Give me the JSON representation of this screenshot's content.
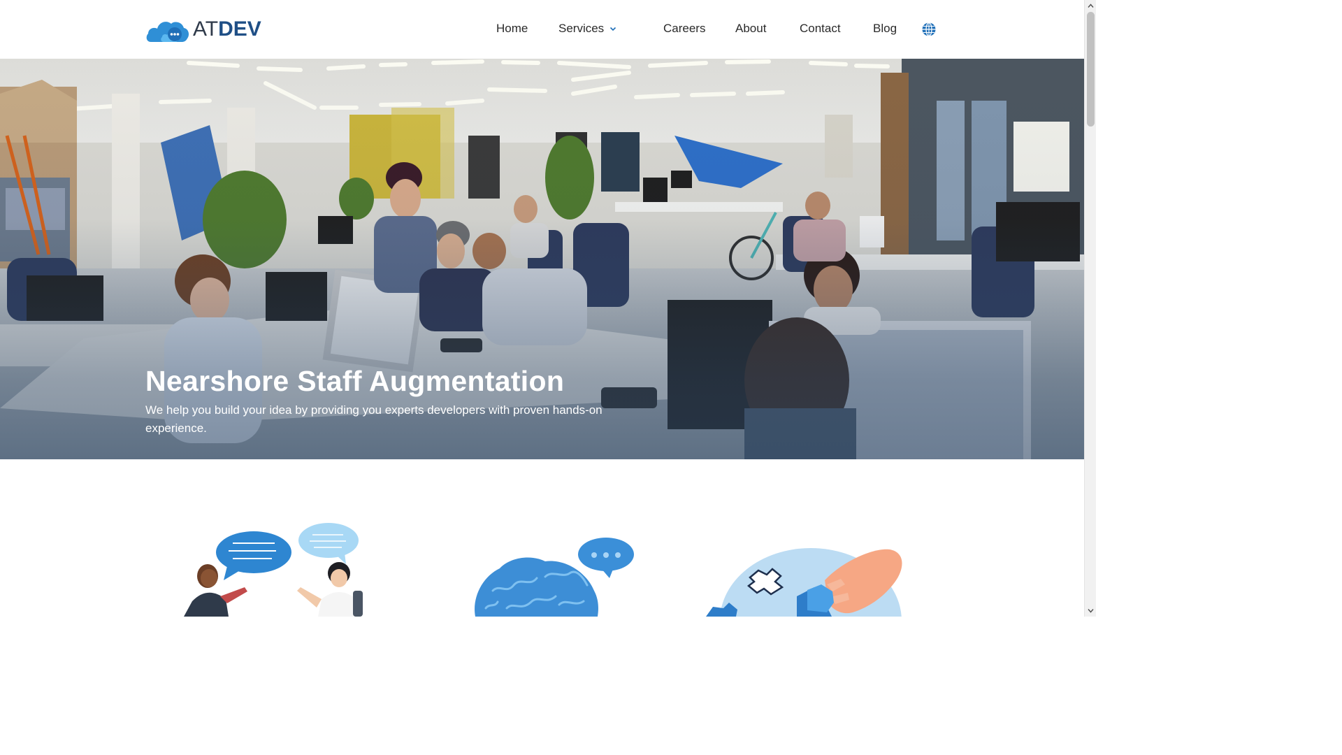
{
  "brand": {
    "logo_prefix": "AT",
    "logo_suffix": "DEV",
    "primary_color": "#1f4f86",
    "accent_color": "#3d9be0"
  },
  "nav": {
    "home": "Home",
    "services": "Services",
    "careers": "Careers",
    "about": "About",
    "contact": "Contact",
    "blog": "Blog",
    "services_icon": "chevron-down-icon",
    "language_icon": "globe-icon"
  },
  "hero": {
    "title": "Nearshore Staff Augmentation",
    "subtitle": "We help you build your idea by providing you experts developers with proven hands-on experience."
  },
  "illustrations": [
    {
      "icon": "conversation-illustration-icon"
    },
    {
      "icon": "brain-illustration-icon"
    },
    {
      "icon": "puzzle-illustration-icon"
    }
  ]
}
